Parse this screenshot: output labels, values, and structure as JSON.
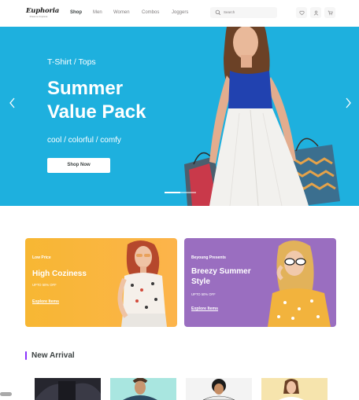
{
  "header": {
    "logo": "Euphoria",
    "logo_tagline": "Dress to Impress",
    "nav": [
      {
        "label": "Shop",
        "active": true
      },
      {
        "label": "Men",
        "active": false
      },
      {
        "label": "Women",
        "active": false
      },
      {
        "label": "Combos",
        "active": false
      },
      {
        "label": "Joggers",
        "active": false
      }
    ],
    "search_placeholder": "Search",
    "icons": [
      "heart-icon",
      "user-icon",
      "cart-icon"
    ]
  },
  "hero": {
    "eyebrow": "T-Shirt / Tops",
    "title_line1": "Summer",
    "title_line2": "Value Pack",
    "subtitle": "cool / colorful / comfy",
    "cta": "Shop Now",
    "background": "#1eb0de",
    "slides": 2,
    "active_slide": 1
  },
  "promos": [
    {
      "kicker": "Low Price",
      "title_line1": "High Coziness",
      "title_line2": "",
      "offer": "UPTO 50% OFF",
      "cta": "Explore Items",
      "color": "#f7b733"
    },
    {
      "kicker": "Beyoung Presents",
      "title_line1": "Breezy Summer",
      "title_line2": "Style",
      "offer": "UPTO 50% OFF",
      "cta": "Explore Items",
      "color": "#9a6ec0"
    }
  ],
  "new_arrival": {
    "title": "New Arrival",
    "accent": "#8a33fd"
  }
}
